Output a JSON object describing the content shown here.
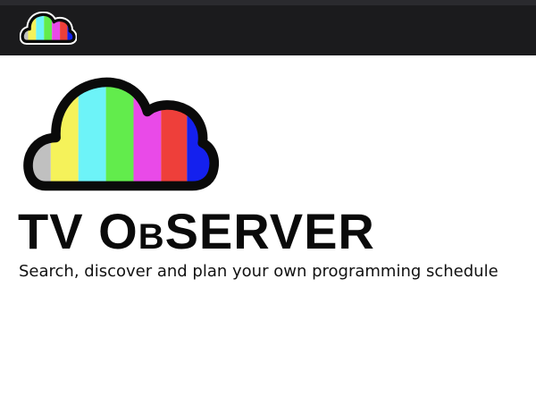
{
  "header": {
    "logo_icon": "cloud-tv-logo-icon"
  },
  "hero": {
    "logo_icon": "cloud-tv-logo-icon",
    "title_part1": "TV O",
    "title_part2": "B",
    "title_part3": "SERVER",
    "subtitle": "Search, discover and plan your own programming schedule"
  },
  "colors": {
    "header_bg": "#1b1b1d",
    "logo_stripes": [
      "#c0c0c0",
      "#f5f25a",
      "#6df3f8",
      "#62ec4c",
      "#e94ae8",
      "#ee3f3a",
      "#1420ee"
    ],
    "logo_outline": "#0a0a0a"
  }
}
